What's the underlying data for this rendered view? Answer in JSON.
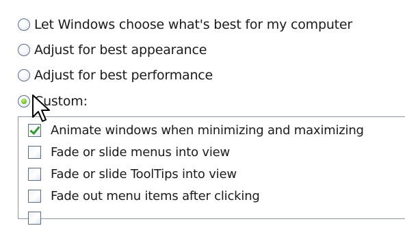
{
  "performance_options": {
    "radio_options": [
      {
        "label": "Let Windows choose what's best for my computer",
        "selected": false
      },
      {
        "label": "Adjust for best appearance",
        "selected": false
      },
      {
        "label": "Adjust for best performance",
        "selected": false
      },
      {
        "label": "Custom:",
        "selected": true
      }
    ],
    "visual_effects": [
      {
        "label": "Animate windows when minimizing and maximizing",
        "checked": true
      },
      {
        "label": "Fade or slide menus into view",
        "checked": false
      },
      {
        "label": "Fade or slide ToolTips into view",
        "checked": false
      },
      {
        "label": "Fade out menu items after clicking",
        "checked": false
      }
    ]
  },
  "colors": {
    "radio_selected": "#7bc72d",
    "checkmark": "#2f9a2f",
    "border": "#5b6e8a"
  }
}
